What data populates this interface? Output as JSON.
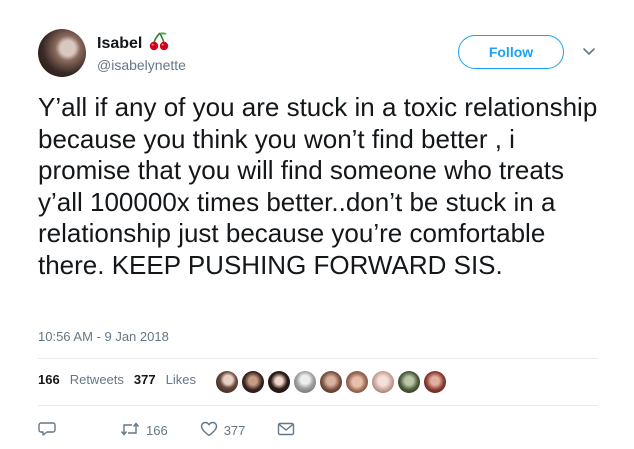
{
  "user": {
    "name": "Isabel",
    "handle": "@isabelynette"
  },
  "follow_label": "Follow",
  "tweet": {
    "text": "Y’all if any of you are stuck in a toxic relationship because you think you won’t find better , i promise that you will find someone who treats y’all 100000x times better..don’t be stuck in a relationship just because you’re comfortable there. KEEP PUSHING FORWARD SIS.",
    "timestamp": "10:56 AM - 9 Jan 2018"
  },
  "stats": {
    "retweets": "166",
    "retweets_label": "Retweets",
    "likes": "377",
    "likes_label": "Likes"
  },
  "actions": {
    "retweet_count": "166",
    "like_count": "377"
  },
  "colors": {
    "accent": "#1da1f2",
    "secondary_text": "#657786",
    "divider": "#e6ecf0"
  },
  "icons": [
    "cherry-icon",
    "chevron-down-icon",
    "reply-icon",
    "retweet-icon",
    "like-icon",
    "message-icon"
  ]
}
